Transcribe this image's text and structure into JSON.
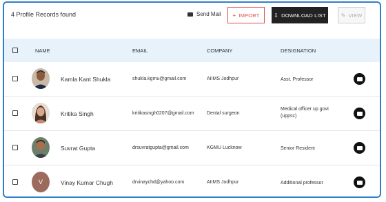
{
  "header": {
    "records_found": "4 Profile Records found",
    "send_mail": "Send Mail",
    "import_label": "IMPORT",
    "download_label": "DOWNLOAD LIST",
    "view_label": "VIEW"
  },
  "table": {
    "columns": {
      "name": "NAME",
      "email": "EMAIL",
      "company": "COMPANY",
      "designation": "DESIGNATION"
    },
    "rows": [
      {
        "name": "Kamla Kant Shukla",
        "email": "shukla.kgmu@gmail.com",
        "company": "AIIMS Jodhpur",
        "designation": "Asst. Professor",
        "avatar": "photo"
      },
      {
        "name": "Kritika Singh",
        "email": "kritikasingh0207@gmail.com",
        "company": "Dental surgeon",
        "designation": "Medical officer up govt (uppsc)",
        "avatar": "photo"
      },
      {
        "name": "Suvrat Gupta",
        "email": "drsuvratgupta@gmail.com",
        "company": "KGMU Lucknow",
        "designation": "Senior Resident",
        "avatar": "photo"
      },
      {
        "name": "Vinay Kumar Chugh",
        "email": "drvinaychd@yahoo.com",
        "company": "AIIMS Jodhpur",
        "designation": "Additional professor",
        "avatar": "letter",
        "avatar_letter": "V"
      }
    ]
  },
  "colors": {
    "frame_border": "#2f7fc8",
    "header_bg": "#e7f2fb",
    "import_accent": "#e24a4a",
    "download_bg": "#222222"
  }
}
